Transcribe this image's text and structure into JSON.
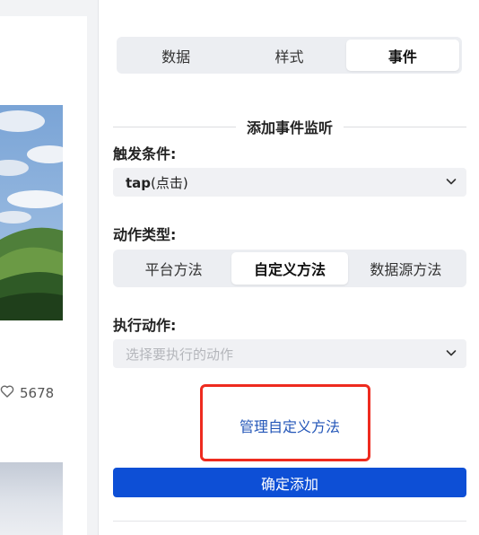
{
  "tabs": [
    {
      "label": "数据",
      "active": false
    },
    {
      "label": "样式",
      "active": false
    },
    {
      "label": "事件",
      "active": true
    }
  ],
  "section_title": "添加事件监听",
  "trigger": {
    "label": "触发条件:",
    "value_main": "tap",
    "value_suffix": "(点击)"
  },
  "action_type": {
    "label": "动作类型:",
    "options": [
      {
        "label": "平台方法",
        "active": false
      },
      {
        "label": "自定义方法",
        "active": true
      },
      {
        "label": "数据源方法",
        "active": false
      }
    ]
  },
  "execute": {
    "label": "执行动作:",
    "placeholder": "选择要执行的动作"
  },
  "manage_link": "管理自定义方法",
  "confirm_button": "确定添加",
  "left_preview": {
    "like_count": "5678"
  },
  "colors": {
    "accent": "#0d4fd6",
    "link": "#2356b8",
    "highlight": "#ee2b1f"
  },
  "icons": [
    "chevron-down-icon",
    "heart-icon"
  ]
}
